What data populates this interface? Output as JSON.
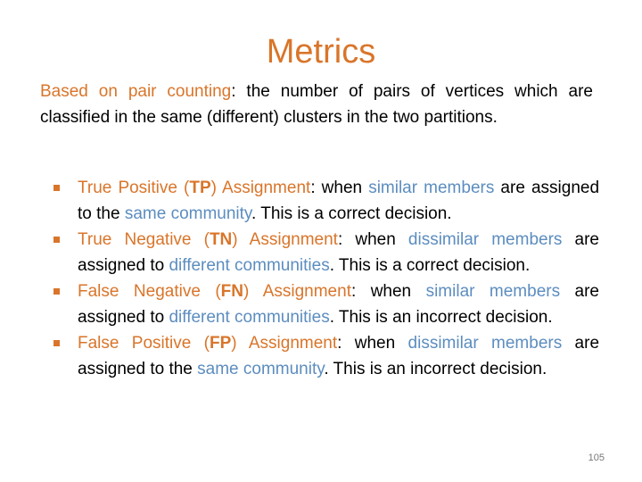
{
  "slide": {
    "title": "Metrics",
    "intro": {
      "highlight": "Based on pair counting",
      "rest": ": the number of pairs of vertices which are classified in the same (different) clusters in the two partitions."
    },
    "bullets": [
      {
        "pre": "True Positive (",
        "abbr": "TP",
        "post": ") Assignment",
        "t1": ": when ",
        "b1": "similar members",
        "t2": " are assigned to the ",
        "b2": "same community",
        "t3": ". This is a correct decision."
      },
      {
        "pre": "True Negative (",
        "abbr": "TN",
        "post": ") Assignment",
        "t1": ": when ",
        "b1": "dissimilar members",
        "t2": " are assigned to ",
        "b2": "different communities",
        "t3": ". This is a correct decision."
      },
      {
        "pre": "False Negative (",
        "abbr": "FN",
        "post": ") Assignment",
        "t1": ": when ",
        "b1": "similar members",
        "t2": " are assigned to ",
        "b2": "different communities",
        "t3": ". This is an incorrect decision."
      },
      {
        "pre": "False Positive (",
        "abbr": "FP",
        "post": ") Assignment",
        "t1": ": when ",
        "b1": "dissimilar members",
        "t2": " are assigned to the ",
        "b2": "same community",
        "t3": ". This is an incorrect decision."
      }
    ],
    "page_number": "105",
    "colors": {
      "accent": "#D9752A",
      "highlight_blue": "#5C8DBF",
      "text": "#000000"
    }
  }
}
